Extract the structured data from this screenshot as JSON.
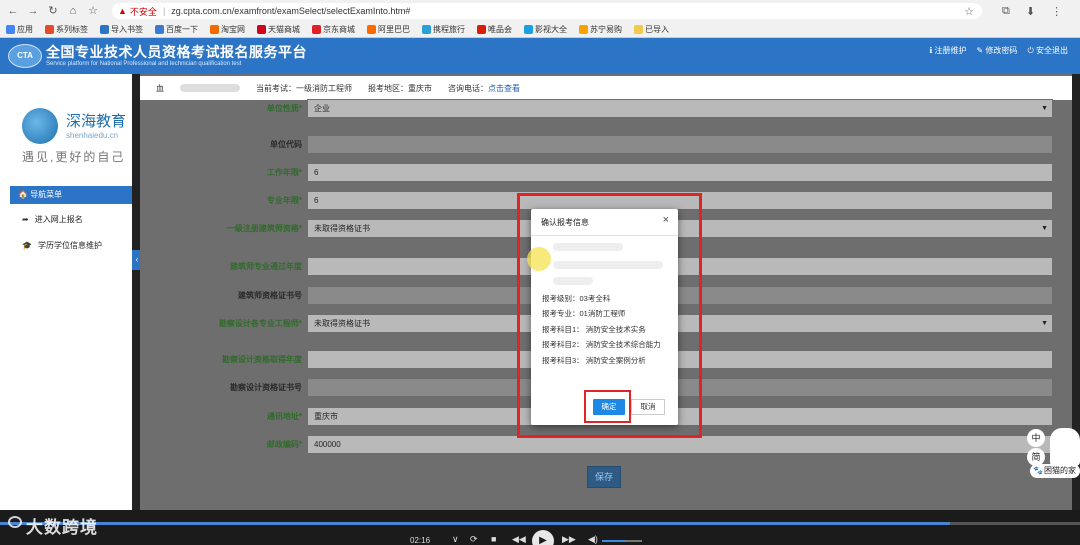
{
  "browser": {
    "not_secure": "不安全",
    "url": "zg.cpta.com.cn/examfront/examSelect/selectExamInto.htm#",
    "bookmarks": [
      "应用",
      "系列标签",
      "导入书签",
      "百度一下",
      "淘宝网",
      "天猫商城",
      "京东商城",
      "阿里巴巴",
      "携程旅行",
      "唯品会",
      "影视大全",
      "苏宁易购",
      "已导入"
    ]
  },
  "site": {
    "logo": "CTA",
    "title": "全国专业技术人员资格考试报名服务平台",
    "subtitle": "Service platform for National Professional and technician qualification test",
    "links": [
      "注册维护",
      "修改密码",
      "安全退出"
    ]
  },
  "sidebar": {
    "brand": "深海教育",
    "domain": "shenhaiedu.cn",
    "slogan": "遇见,更好的自己",
    "menu_head": "导航菜单",
    "items": [
      "进入网上报名",
      "学历学位信息维护"
    ],
    "collapse": "‹"
  },
  "infobar": {
    "prefix": "血",
    "current_exam": "当前考试：一级消防工程师",
    "region": "报考地区：重庆市",
    "phone_label": "咨询电话：",
    "phone_link": "点击查看"
  },
  "form": {
    "rows": [
      {
        "label": "单位性质*",
        "value": "企业",
        "select": true,
        "plain": false
      },
      {
        "label": "单位代码",
        "value": "",
        "select": false,
        "plain": true
      },
      {
        "label": "工作年限*",
        "value": "6",
        "select": false,
        "plain": false
      },
      {
        "label": "专业年限*",
        "value": "6",
        "select": false,
        "plain": false
      },
      {
        "label": "一级注册建筑师资格*",
        "value": "未取得资格证书",
        "select": true,
        "plain": false
      },
      {
        "label": "建筑师专业通过年度",
        "value": "",
        "select": false,
        "plain": false
      },
      {
        "label": "建筑师资格证书号",
        "value": "",
        "select": false,
        "plain": true
      },
      {
        "label": "勘察设计各专业工程师*",
        "value": "未取得资格证书",
        "select": true,
        "plain": false
      },
      {
        "label": "勘察设计资格取得年度",
        "value": "",
        "select": false,
        "plain": false
      },
      {
        "label": "勘察设计资格证书号",
        "value": "",
        "select": false,
        "plain": true
      },
      {
        "label": "通讯地址*",
        "value": "重庆市",
        "select": false,
        "plain": false
      },
      {
        "label": "邮政编码*",
        "value": "400000",
        "select": false,
        "plain": false
      }
    ],
    "save": "保存"
  },
  "modal": {
    "title": "确认报考信息",
    "close": "×",
    "lines": [
      "报考级别：03考全科",
      "报考专业：01消防工程师",
      "报考科目1： 消防安全技术实务",
      "报考科目2： 消防安全技术综合能力",
      "报考科目3： 消防安全案例分析"
    ],
    "ok": "确定",
    "cancel": "取消"
  },
  "widgets": {
    "lang": "中",
    "simp": "简",
    "sleepy": "困猫的家"
  },
  "player": {
    "watermark": "大数跨境",
    "time": "02:16",
    "progress": 0.88,
    "volume": 0.6
  }
}
